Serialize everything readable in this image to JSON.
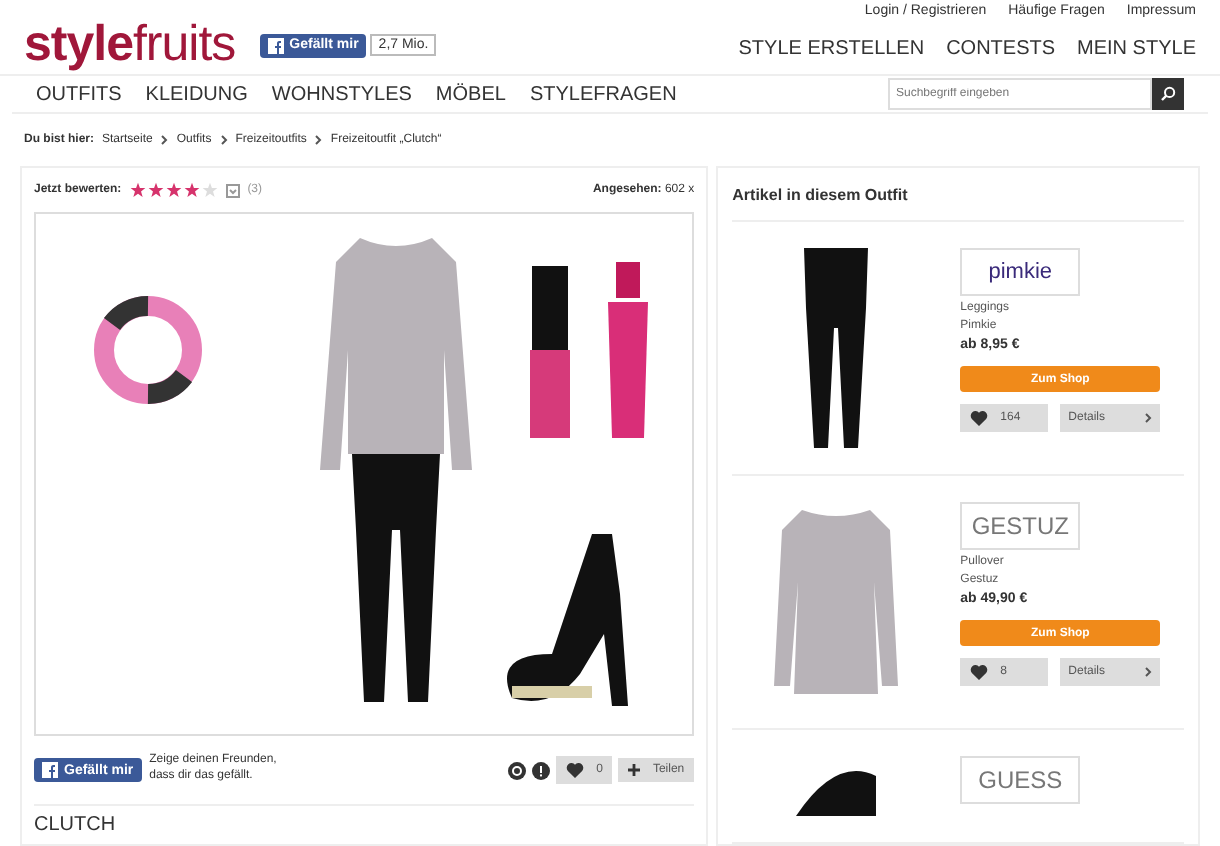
{
  "logo": {
    "part_1": "style",
    "part_2": "fruits"
  },
  "facebook_like": {
    "label": "Gefällt mir",
    "count": "2,7 Mio."
  },
  "top_links": [
    "Login / Registrieren",
    "Häufige Fragen",
    "Impressum"
  ],
  "main_nav": [
    "STYLE ERSTELLEN",
    "CONTESTS",
    "MEIN STYLE"
  ],
  "category_nav": [
    "OUTFITS",
    "KLEIDUNG",
    "WOHNSTYLES",
    "MÖBEL",
    "STYLEFRAGEN"
  ],
  "search": {
    "placeholder": "Suchbegriff eingeben"
  },
  "breadcrumb": {
    "label": "Du bist hier:",
    "items": [
      "Startseite",
      "Outfits",
      "Freizeitoutfits",
      "Freizeitoutfit „Clutch“"
    ]
  },
  "rating": {
    "label": "Jetzt bewerten:",
    "stars": 4,
    "count": "(3)"
  },
  "views": {
    "label": "Angesehen:",
    "value": "602 x"
  },
  "share_bar": {
    "like_label": "Gefällt mir",
    "like_text": "Zeige deinen Freunden, dass dir das gefällt.",
    "likes": "0",
    "share": "Teilen"
  },
  "outfit_title": "CLUTCH",
  "articles": {
    "title": "Artikel in diesem Outfit",
    "items": [
      {
        "kind": "leggings",
        "brand_logo": "pimkie",
        "type": "Leggings",
        "brand": "Pimkie",
        "price": "ab 8,95 €",
        "shop": "Zum Shop",
        "likes": "164",
        "details": "Details"
      },
      {
        "kind": "pullover",
        "brand_logo": "GESTUZ",
        "type": "Pullover",
        "brand": "Gestuz",
        "price": "ab 49,90 €",
        "shop": "Zum Shop",
        "likes": "8",
        "details": "Details"
      },
      {
        "kind": "bag",
        "brand_logo": "GUESS"
      }
    ]
  }
}
